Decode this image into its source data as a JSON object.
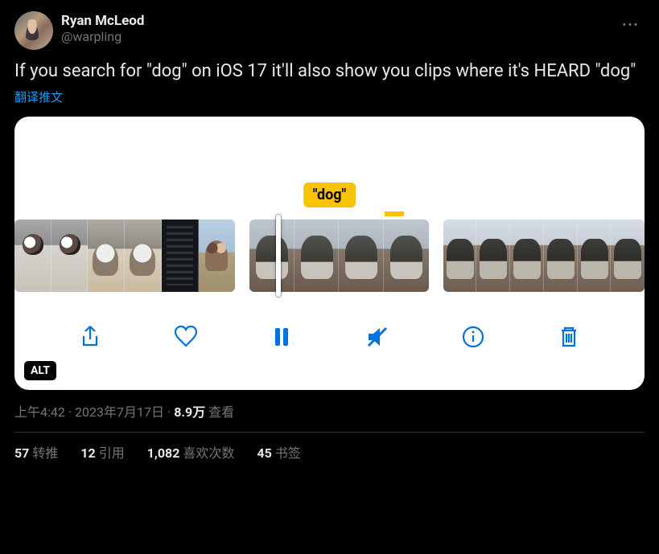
{
  "author": {
    "display_name": "Ryan McLeod",
    "handle": "@warpling"
  },
  "tweet_text": "If you search for \"dog\" on iOS 17 it'll also show you clips where it's HEARD \"dog\"",
  "translate_label": "翻译推文",
  "media": {
    "badge_text": "\"dog\"",
    "alt_badge": "ALT"
  },
  "meta": {
    "time": "上午4:42",
    "date": "2023年7月17日",
    "views_count": "8.9万",
    "views_label": "查看"
  },
  "stats": {
    "retweets_count": "57",
    "retweets_label": "转推",
    "quotes_count": "12",
    "quotes_label": "引用",
    "likes_count": "1,082",
    "likes_label": "喜欢次数",
    "bookmarks_count": "45",
    "bookmarks_label": "书签"
  }
}
